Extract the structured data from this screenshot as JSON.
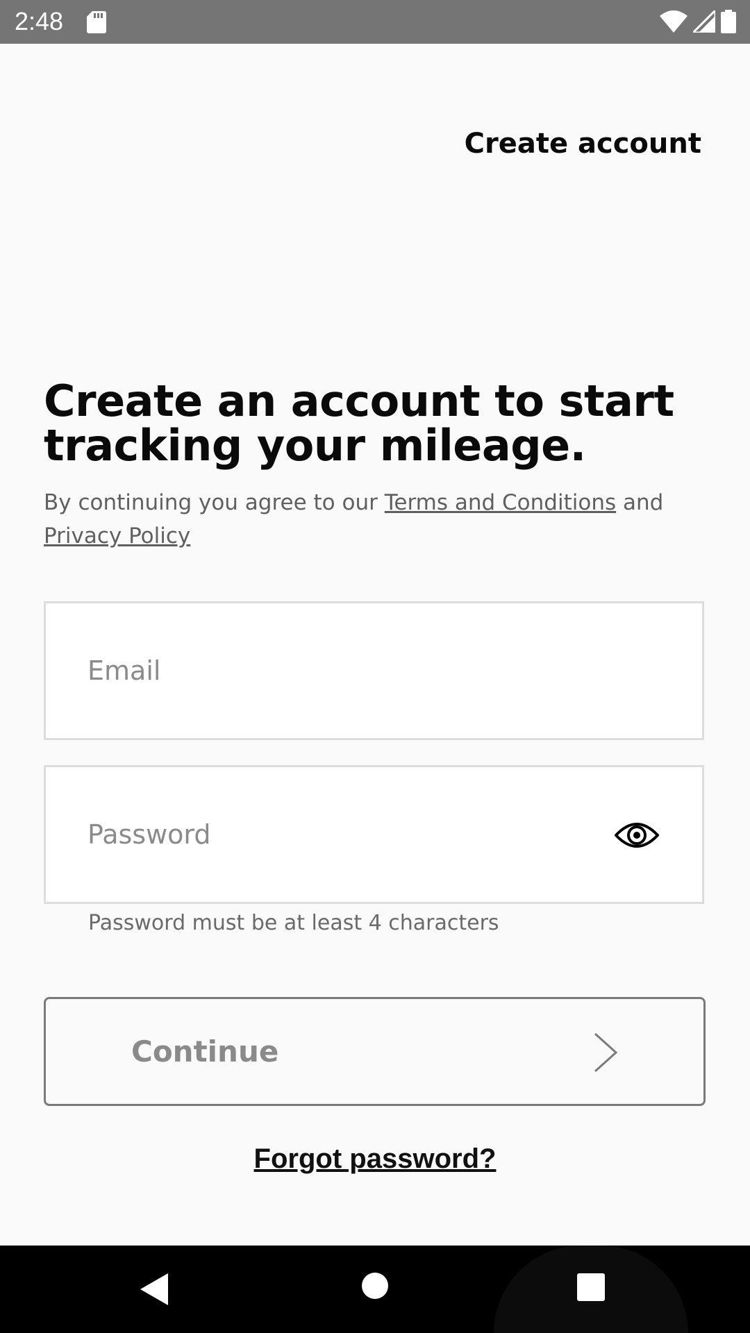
{
  "status_bar": {
    "time": "2:48",
    "icons": [
      "sd-card-icon",
      "wifi-icon",
      "cell-signal-icon",
      "battery-icon"
    ]
  },
  "header": {
    "create_account_label": "Create account"
  },
  "main": {
    "title": "Create an account to start tracking your mileage.",
    "legal_prefix": "By continuing you agree to our ",
    "terms_link": "Terms and Conditions",
    "legal_and": " and ",
    "privacy_link": "Privacy Policy",
    "email": {
      "placeholder": "Email",
      "value": ""
    },
    "password": {
      "placeholder": "Password",
      "value": "",
      "helper": "Password must be at least 4 characters",
      "toggle_icon": "eye-icon"
    },
    "continue_label": "Continue",
    "continue_icon": "chevron-right-icon",
    "forgot_password": "Forgot password?"
  },
  "nav_bar": {
    "buttons": [
      "back-icon",
      "home-icon",
      "recent-apps-icon"
    ]
  },
  "colors": {
    "background": "#fafafa",
    "status_bar": "#757575",
    "text_primary": "#0a0a0a",
    "text_secondary": "#5f5f5f",
    "placeholder": "#8a8a8a",
    "button_border": "#7a7a7a",
    "field_border": "#dcdcdc",
    "nav_bar": "#000000"
  }
}
